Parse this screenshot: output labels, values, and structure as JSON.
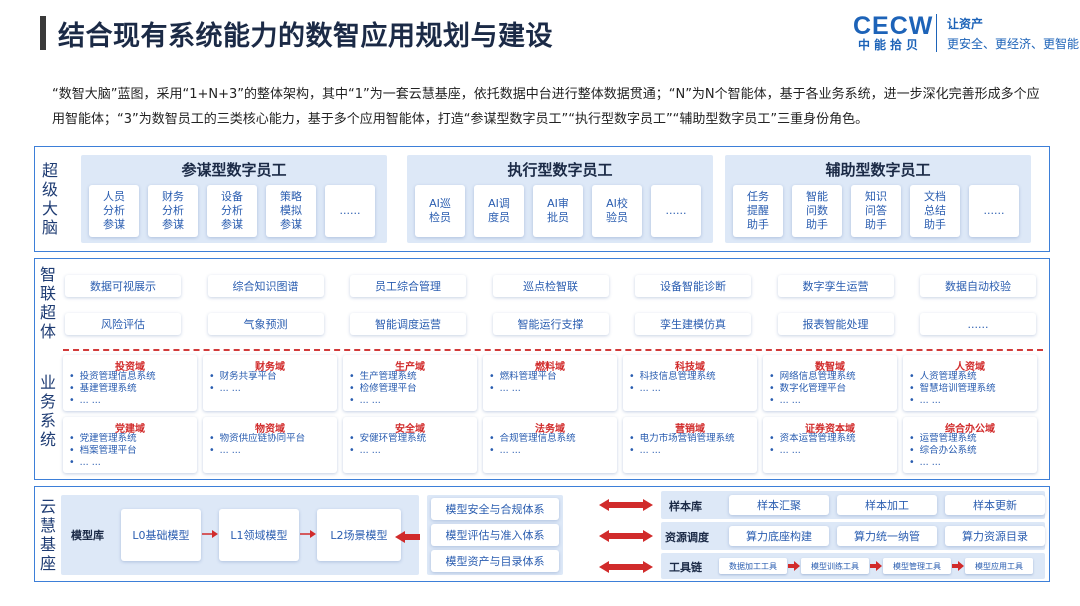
{
  "header": {
    "title": "结合现有系统能力的数智应用规划与建设",
    "logo_text": "CECW",
    "logo_sub": "中能拾贝",
    "slogan_line1": "让资产",
    "slogan_line2": "更安全、更经济、更智能"
  },
  "intro": "“数智大脑”蓝图，采用“1+N+3”的整体架构，其中“1”为一套云慧基座，依托数据中台进行整体数据贯通；“N”为N个智能体，基于各业务系统，进一步深化完善形成多个应用智能体；“3”为数智员工的三类核心能力，基于多个应用智能体，打造“参谋型数字员工”“执行型数字员工”“辅助型数字员工”三重身份角色。",
  "super_brain": {
    "label_chars": [
      "超",
      "级",
      "大",
      "脑"
    ],
    "groups": [
      {
        "title": "参谋型数字员工",
        "cards": [
          "人员\n分析\n参谋",
          "财务\n分析\n参谋",
          "设备\n分析\n参谋",
          "策略\n模拟\n参谋",
          "......"
        ]
      },
      {
        "title": "执行型数字员工",
        "cards": [
          "AI巡\n检员",
          "AI调\n度员",
          "AI审\n批员",
          "AI校\n验员",
          "......"
        ]
      },
      {
        "title": "辅助型数字员工",
        "cards": [
          "任务\n提醒\n助手",
          "智能\n问数\n助手",
          "知识\n问答\n助手",
          "文档\n总结\n助手",
          "......"
        ]
      }
    ]
  },
  "smart_body": {
    "label_chars": [
      "智",
      "联",
      "超",
      "体"
    ],
    "row1": [
      "数据可视展示",
      "综合知识图谱",
      "员工综合管理",
      "巡点检智联",
      "设备智能诊断",
      "数字孪生运营",
      "数据自动校验"
    ],
    "row2": [
      "风险评估",
      "气象预测",
      "智能调度运营",
      "智能运行支撑",
      "孪生建模仿真",
      "报表智能处理",
      "......"
    ]
  },
  "business": {
    "label_chars": [
      "业",
      "务",
      "系",
      "统"
    ],
    "row1": [
      {
        "title": "投资域",
        "items": [
          "投资管理信息系统",
          "基建管理系统",
          "... ..."
        ]
      },
      {
        "title": "财务域",
        "items": [
          "财务共享平台",
          "... ..."
        ]
      },
      {
        "title": "生产域",
        "items": [
          "生产管理系统",
          "检修管理平台",
          "... ..."
        ]
      },
      {
        "title": "燃料域",
        "items": [
          "燃料管理平台",
          "... ..."
        ]
      },
      {
        "title": "科技域",
        "items": [
          "科技信息管理系统",
          "... ..."
        ]
      },
      {
        "title": "数智域",
        "items": [
          "网络信息管理系统",
          "数字化管理平台",
          "... ..."
        ]
      },
      {
        "title": "人资域",
        "items": [
          "人资管理系统",
          "智慧培训管理系统",
          "... ..."
        ]
      }
    ],
    "row2": [
      {
        "title": "党建域",
        "items": [
          "党建管理系统",
          "档案管理平台",
          "... ..."
        ]
      },
      {
        "title": "物资域",
        "items": [
          "物资供应链协同平台",
          "... ..."
        ]
      },
      {
        "title": "安全域",
        "items": [
          "安健环管理系统",
          "... ..."
        ]
      },
      {
        "title": "法务域",
        "items": [
          "合规管理信息系统",
          "... ..."
        ]
      },
      {
        "title": "营销域",
        "items": [
          "电力市场营销管理系统",
          "... ..."
        ]
      },
      {
        "title": "证券资本域",
        "items": [
          "资本运营管理系统",
          "... ..."
        ]
      },
      {
        "title": "综合办公域",
        "items": [
          "运营管理系统",
          "综合办公系统",
          "... ..."
        ]
      }
    ]
  },
  "cloud_base": {
    "label_chars": [
      "云",
      "慧",
      "基",
      "座"
    ],
    "model_lib_label": "模型库",
    "models": [
      "L0基础模型",
      "L1领域模型",
      "L2场景模型"
    ],
    "model_systems": [
      "模型安全与合规体系",
      "模型评估与准入体系",
      "模型资产与目录体系"
    ],
    "sample_lib": {
      "label": "样本库",
      "items": [
        "样本汇聚",
        "样本加工",
        "样本更新"
      ]
    },
    "resource": {
      "label": "资源调度",
      "items": [
        "算力底座构建",
        "算力统一纳管",
        "算力资源目录"
      ]
    },
    "toolchain": {
      "label": "工具链",
      "items": [
        "数据加工工具",
        "模型训练工具",
        "模型管理工具",
        "模型应用工具"
      ]
    }
  },
  "colors": {
    "accent": "#3d7fd8",
    "brand": "#1d63b8",
    "arrow_red": "#d12b2b",
    "group_bg": "#dde8f7"
  }
}
